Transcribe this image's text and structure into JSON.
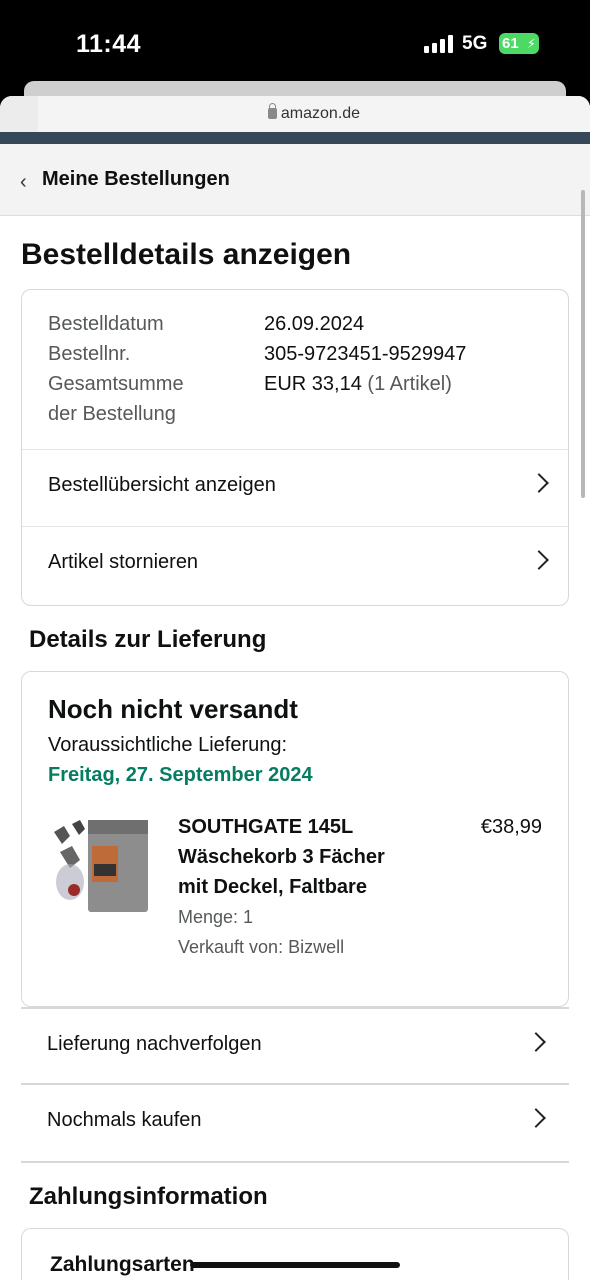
{
  "status_bar": {
    "time": "11:44",
    "network": "5G",
    "battery": "61"
  },
  "browser": {
    "url": "amazon.de"
  },
  "back_nav": {
    "label": "Meine Bestellungen"
  },
  "page_title": "Bestelldetails anzeigen",
  "order_summary": {
    "date_label": "Bestelldatum",
    "date_value": "26.09.2024",
    "number_label": "Bestellnr.",
    "number_value": "305-9723451-9529947",
    "total_label_line1": "Gesamtsumme",
    "total_label_line2": "der Bestellung",
    "total_value": "EUR 33,14",
    "total_items": "(1 Artikel)",
    "links": [
      {
        "label": "Bestellübersicht anzeigen"
      },
      {
        "label": "Artikel stornieren"
      }
    ]
  },
  "delivery": {
    "heading": "Details zur Lieferung",
    "status": "Noch nicht versandt",
    "eta_label": "Voraussichtliche Lieferung:",
    "eta_date": "Freitag, 27. September 2024",
    "eta_color": "#067d62",
    "item": {
      "name": "SOUTHGATE 145L Wäschekorb 3 Fächer mit Deckel, Faltbare",
      "price": "€38,99",
      "quantity": "Menge: 1",
      "seller": "Verkauft von: Bizwell"
    }
  },
  "actions": [
    {
      "label": "Lieferung nachverfolgen"
    },
    {
      "label": "Nochmals kaufen"
    }
  ],
  "payment": {
    "heading": "Zahlungsinformation",
    "methods_label": "Zahlungsarten"
  }
}
